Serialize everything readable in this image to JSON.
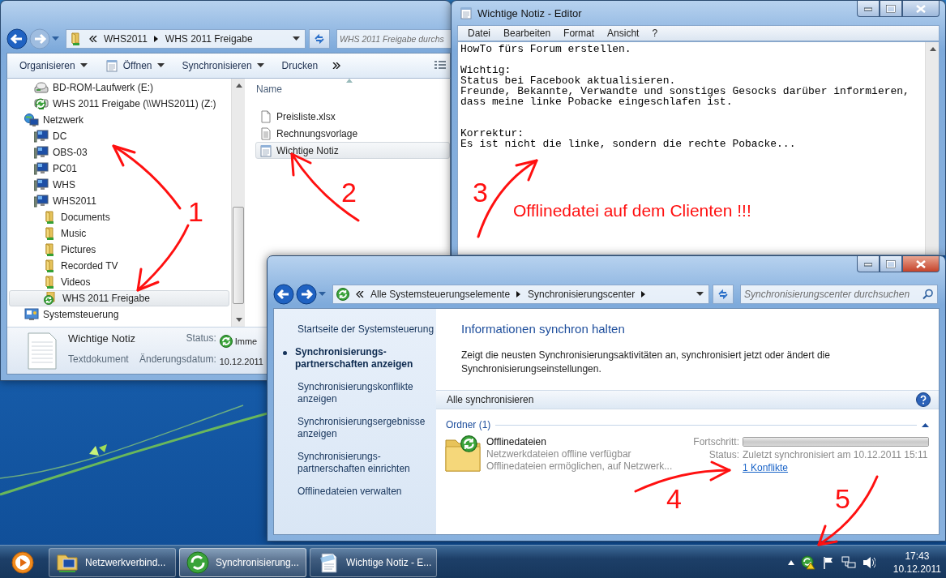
{
  "explorer": {
    "address": {
      "path": [
        "WHS2011",
        "WHS 2011 Freigabe"
      ]
    },
    "search": {
      "placeholder": "WHS 2011 Freigabe durchs"
    },
    "toolbar": [
      {
        "label": "Organisieren",
        "kind": "menu",
        "dropdown": true
      },
      {
        "label": "Öffnen",
        "kind": "open",
        "dropdown": true
      },
      {
        "label": "Synchronisieren",
        "kind": "menu",
        "dropdown": true
      },
      {
        "label": "Drucken",
        "kind": "command",
        "dropdown": false
      }
    ],
    "tree": {
      "partial_children": [
        {
          "label": "BD-ROM-Laufwerk (E:)",
          "kind": "optical-drive",
          "selected": false
        },
        {
          "label": "WHS 2011 Freigabe (\\\\WHS2011) (Z:)",
          "kind": "network-drive",
          "selected": false
        }
      ],
      "items": [
        {
          "label": "Netzwerk",
          "kind": "network",
          "selected": false,
          "children": [
            {
              "label": "DC",
              "kind": "computer",
              "selected": false
            },
            {
              "label": "OBS-03",
              "kind": "computer",
              "selected": false
            },
            {
              "label": "PC01",
              "kind": "computer",
              "selected": false
            },
            {
              "label": "WHS",
              "kind": "computer",
              "selected": false
            },
            {
              "label": "WHS2011",
              "kind": "computer",
              "selected": false,
              "children": [
                {
                  "label": "Documents",
                  "kind": "share",
                  "selected": false
                },
                {
                  "label": "Music",
                  "kind": "share",
                  "selected": false
                },
                {
                  "label": "Pictures",
                  "kind": "share",
                  "selected": false
                },
                {
                  "label": "Recorded TV",
                  "kind": "share",
                  "selected": false
                },
                {
                  "label": "Videos",
                  "kind": "share",
                  "selected": false
                },
                {
                  "label": "WHS 2011 Freigabe",
                  "kind": "synced-share",
                  "selected": true
                }
              ]
            }
          ]
        },
        {
          "label": "Systemsteuerung",
          "kind": "control-panel",
          "selected": false
        }
      ]
    },
    "files": {
      "column": "Name",
      "items": [
        {
          "name": "Preisliste.xlsx",
          "kind": "file",
          "selected": false
        },
        {
          "name": "Rechnungsvorlage",
          "kind": "document",
          "selected": false
        },
        {
          "name": "Wichtige Notiz",
          "kind": "text",
          "selected": true
        }
      ]
    },
    "details": {
      "name": "Wichtige Notiz",
      "type": "Textdokument",
      "status_label": "Status:",
      "status": "Imme",
      "date_label": "Änderungsdatum:",
      "date": "10.12.2011"
    }
  },
  "notepad": {
    "title": "Wichtige Notiz - Editor",
    "menu": [
      "Datei",
      "Bearbeiten",
      "Format",
      "Ansicht",
      "?"
    ],
    "text": "HowTo fürs Forum erstellen.\n\nWichtig:\nStatus bei Facebook aktualisieren.\nFreunde, Bekannte, Verwandte und sonstiges Gesocks darüber informieren,\ndass meine linke Pobacke eingeschlafen ist.\n\n\nKorrektur:\nEs ist nicht die linke, sondern die rechte Pobacke..."
  },
  "sync_center": {
    "address": {
      "path": [
        "Alle Systemsteuerungselemente",
        "Synchronisierungscenter"
      ]
    },
    "search": {
      "placeholder": "Synchronisierungscenter durchsuchen"
    },
    "tasks": [
      {
        "label": "Startseite der Systemsteuerung",
        "selected": false
      },
      {
        "label": "Synchronisierungs-partnerschaften anzeigen",
        "selected": true
      },
      {
        "label": "Synchronisierungskonflikte anzeigen",
        "selected": false
      },
      {
        "label": "Synchronisierungsergebnisse anzeigen",
        "selected": false
      },
      {
        "label": "Synchronisierungs-partnerschaften einrichten",
        "selected": false
      },
      {
        "label": "Offlinedateien verwalten",
        "selected": false
      }
    ],
    "heading": "Informationen synchron halten",
    "description": "Zeigt die neusten Synchronisierungsaktivitäten an, synchronisiert jetzt oder ändert die Synchronisierungseinstellungen.",
    "toolbar": {
      "label": "Alle synchronisieren"
    },
    "group": {
      "title": "Ordner (1)",
      "expanded": true
    },
    "item": {
      "name": "Offlinedateien",
      "lines": [
        "Netzwerkdateien offline verfügbar",
        "Offlinedateien ermöglichen, auf Netzwerk..."
      ],
      "progress_label": "Fortschritt:",
      "level": 1,
      "status_label": "Status:",
      "status": "Zuletzt synchronisiert am 10.12.2011 15:11",
      "link": "1 Konflikte"
    }
  },
  "taskbar": {
    "tasks": [
      {
        "label": "Netzwerkverbind...",
        "kind": "network",
        "selected": false
      },
      {
        "label": "Synchronisierung...",
        "kind": "sync",
        "selected": true
      },
      {
        "label": "Wichtige Notiz - E...",
        "kind": "notepad",
        "selected": false
      }
    ],
    "clock": {
      "time": "17:43",
      "date": "10.12.2011"
    }
  },
  "annotations": {
    "markers": [
      "1",
      "2",
      "3",
      "4",
      "5"
    ],
    "callout": "Offlinedatei auf dem Clienten !!!"
  }
}
